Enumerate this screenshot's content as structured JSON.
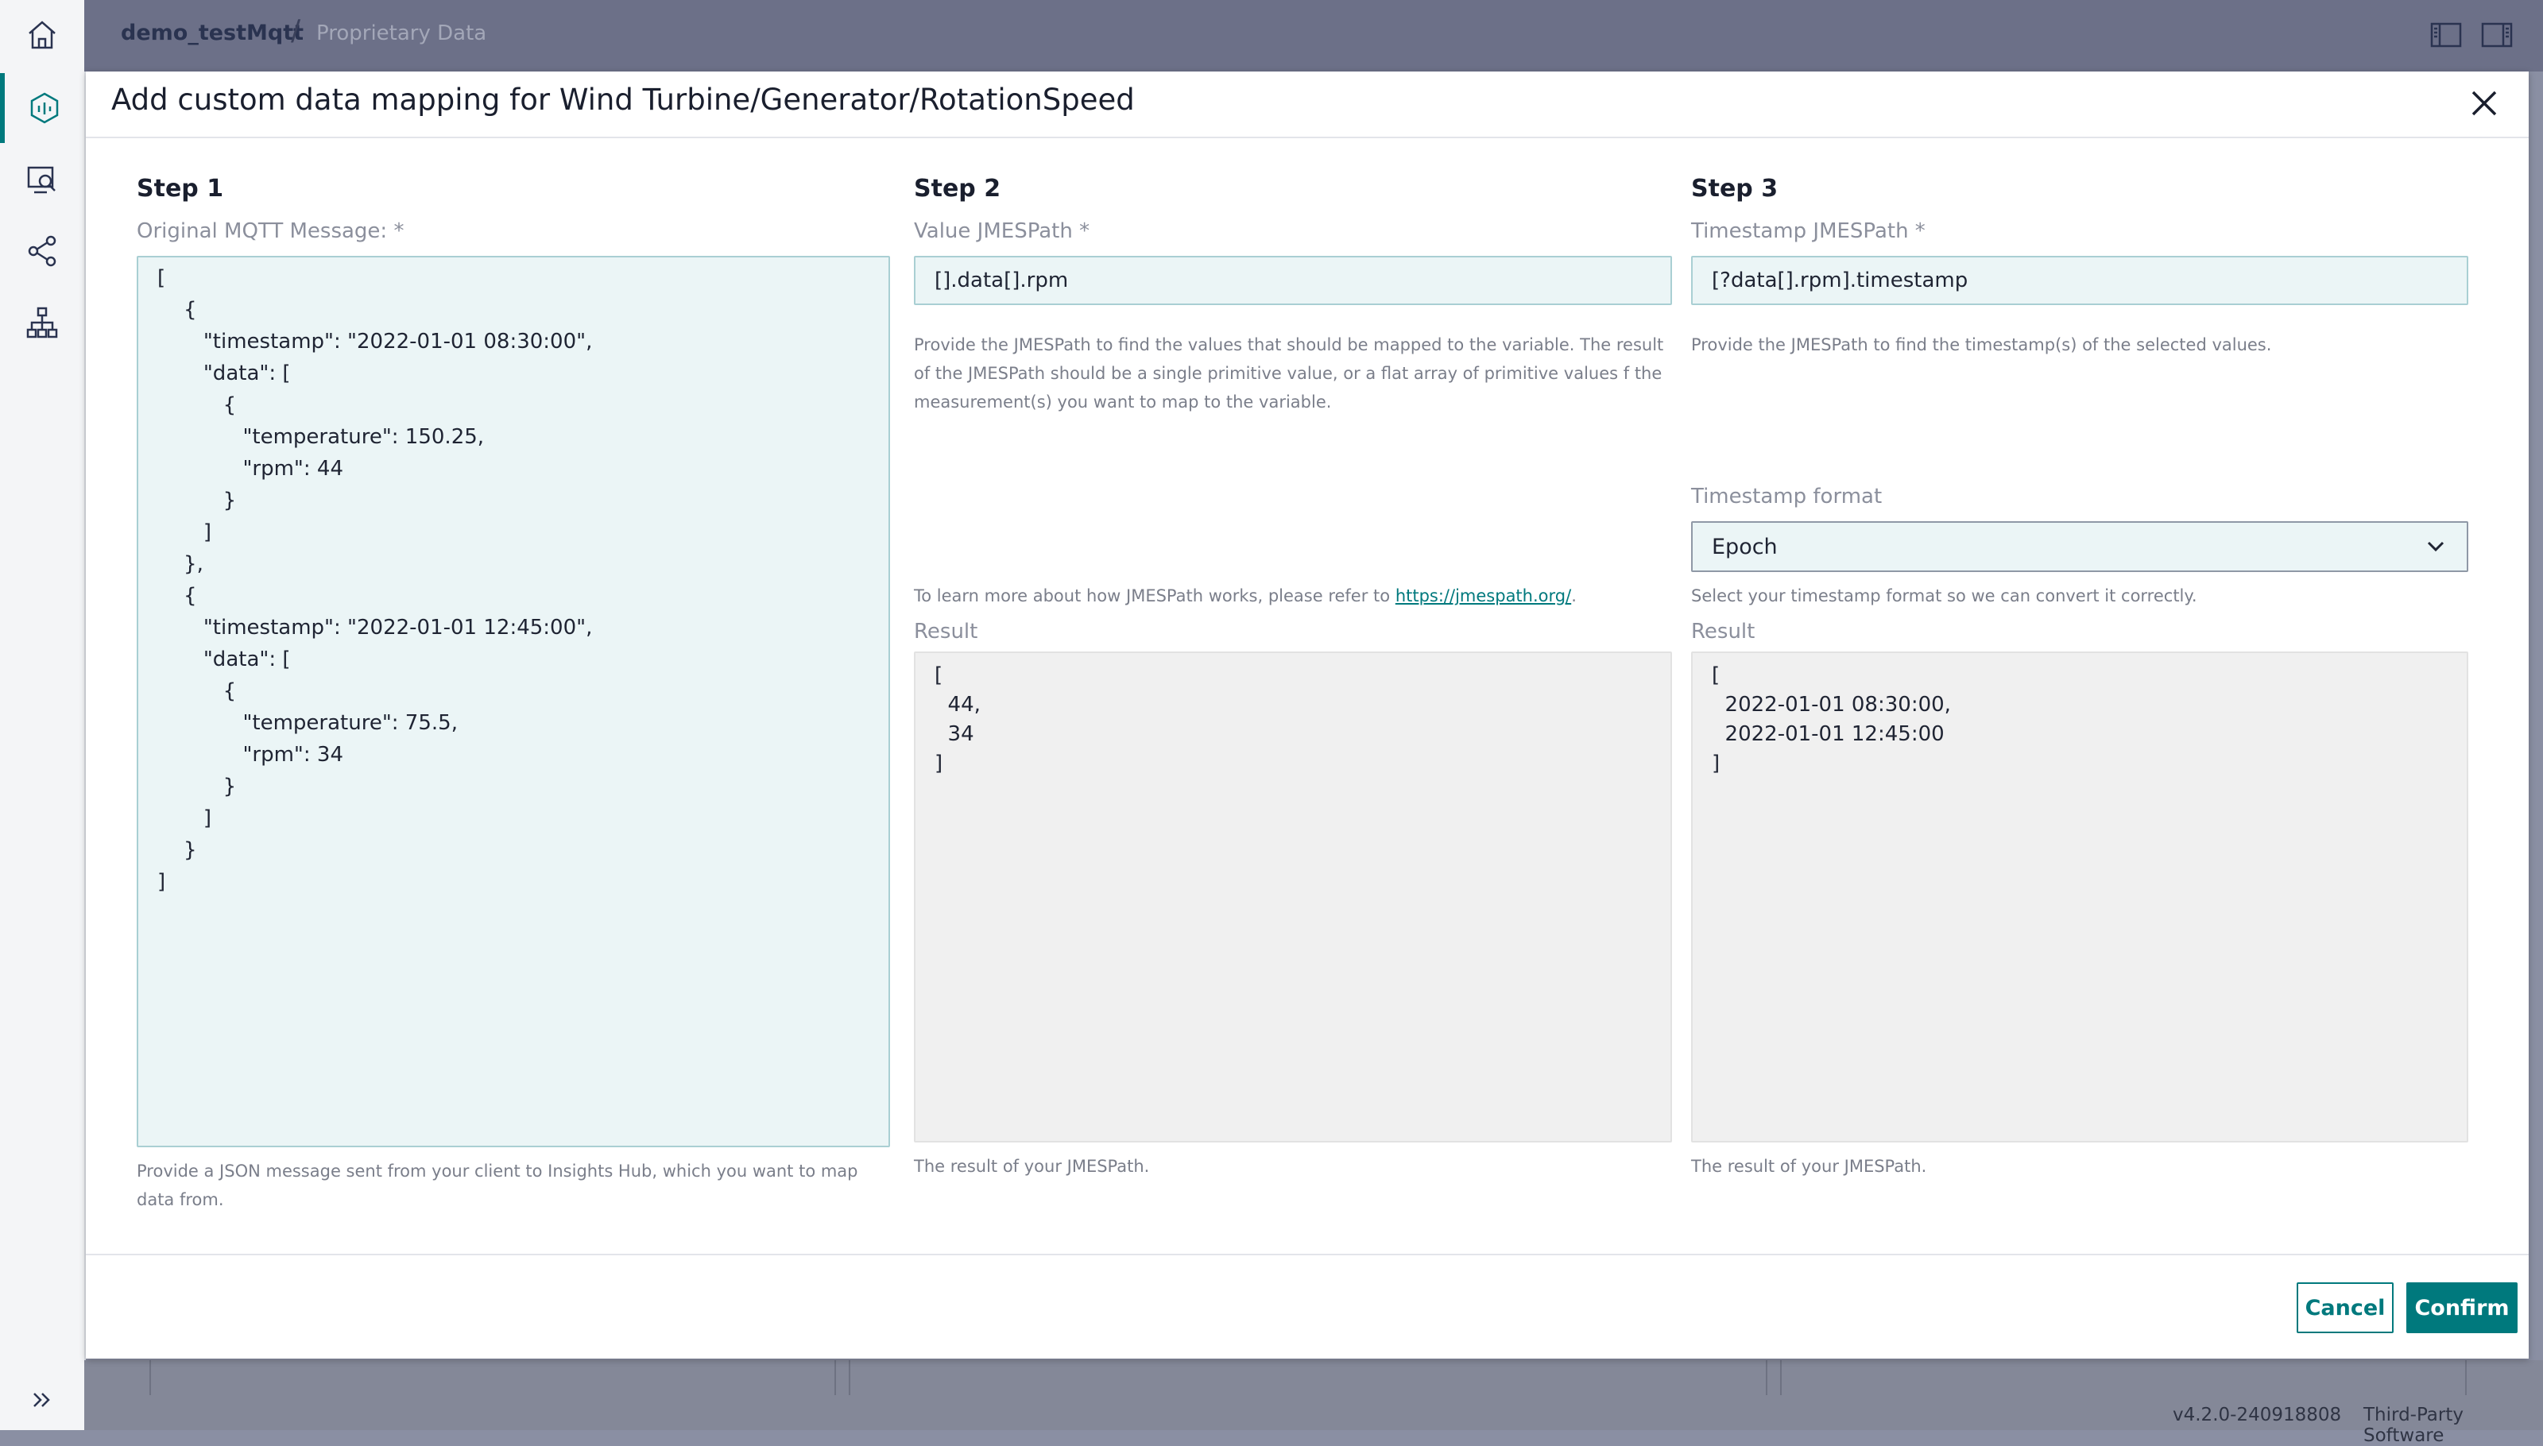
{
  "header": {
    "app_name": "demo_testMqtt",
    "separator": "/",
    "page_name": "Proprietary Data"
  },
  "rail": {
    "icons": [
      "home-icon",
      "data-analysis-icon",
      "monitor-search-icon",
      "share-icon",
      "hierarchy-icon",
      "expand-icon"
    ]
  },
  "dialog": {
    "title": "Add custom data mapping for Wind Turbine/Generator/RotationSpeed",
    "step1": {
      "heading": "Step 1",
      "label": "Original MQTT Message: *",
      "message": "[\n    {\n       \"timestamp\": \"2022-01-01 08:30:00\",\n       \"data\": [\n          {\n             \"temperature\": 150.25,\n             \"rpm\": 44\n          }\n       ]\n    },\n    {\n       \"timestamp\": \"2022-01-01 12:45:00\",\n       \"data\": [\n          {\n             \"temperature\": 75.5,\n             \"rpm\": 34\n          }\n       ]\n    }\n]",
      "hint": "Provide a JSON message sent from your client to Insights Hub, which you want to map data from."
    },
    "step2": {
      "heading": "Step 2",
      "label": "Value JMESPath *",
      "value": "[].data[].rpm",
      "hint": "Provide the JMESPath to find the values that should be mapped to the variable. The result of the JMESPath should be a single primitive value, or a flat array of primitive values f the measurement(s) you want to map to the variable.",
      "learn_more": "To learn more about how JMESPath works, please refer to",
      "learn_more_link": "https://jmespath.org/",
      "learn_more_end": ".",
      "result_label": "Result",
      "result": "[\n  44,\n  34\n]",
      "result_hint": "The result of your JMESPath."
    },
    "step3": {
      "heading": "Step 3",
      "label": "Timestamp JMESPath *",
      "value": "[?data[].rpm].timestamp",
      "hint": "Provide the JMESPath to find the timestamp(s) of the selected values.",
      "format_label": "Timestamp format",
      "format_value": "Epoch",
      "format_hint": "Select your timestamp format so we can convert it correctly.",
      "result_label": "Result",
      "result": "[\n  2022-01-01 08:30:00,\n  2022-01-01 12:45:00\n]",
      "result_hint": "The result of your JMESPath."
    },
    "cancel_label": "Cancel",
    "confirm_label": "Confirm"
  },
  "footer": {
    "version": "v4.2.0-240918808",
    "third_party": "Third-Party Software"
  },
  "colors": {
    "accent": "#00797d",
    "field_bg": "#ebf5f6",
    "result_bg": "#f0f0f0",
    "overlay": "#6c7088"
  }
}
